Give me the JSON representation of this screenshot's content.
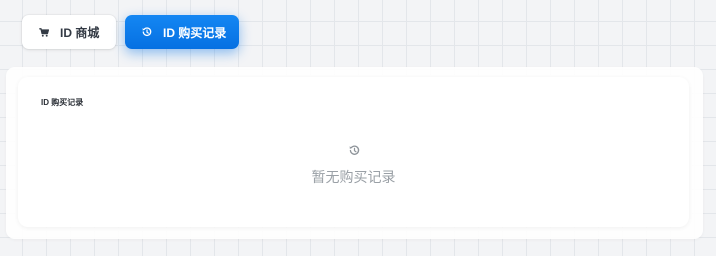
{
  "tabs": {
    "shop": {
      "label": "ID 商城",
      "icon": "cart-icon"
    },
    "records": {
      "label": "ID 购买记录",
      "icon": "history-icon",
      "active": true
    }
  },
  "records_panel": {
    "title": "ID 购买记录",
    "empty_icon": "history-icon",
    "empty_text": "暂无购买记录"
  },
  "colors": {
    "accent": "#0a78ea",
    "background": "#f3f4f6",
    "muted_text": "#9aa0a6"
  }
}
